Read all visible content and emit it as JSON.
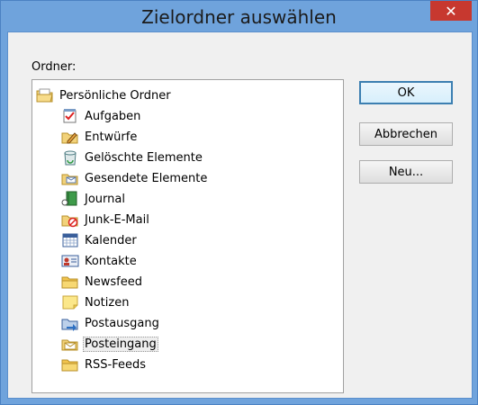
{
  "window": {
    "title": "Zielordner auswählen",
    "close_glyph": "✕"
  },
  "folder_label": "Ordner:",
  "tree": {
    "root": {
      "label": "Persönliche Ordner",
      "icon": "personal-folders-icon"
    },
    "items": [
      {
        "label": "Aufgaben",
        "icon": "tasks-icon"
      },
      {
        "label": "Entwürfe",
        "icon": "drafts-icon"
      },
      {
        "label": "Gelöschte Elemente",
        "icon": "deleted-items-icon"
      },
      {
        "label": "Gesendete Elemente",
        "icon": "sent-items-icon"
      },
      {
        "label": "Journal",
        "icon": "journal-icon"
      },
      {
        "label": "Junk-E-Mail",
        "icon": "junk-mail-icon"
      },
      {
        "label": "Kalender",
        "icon": "calendar-icon"
      },
      {
        "label": "Kontakte",
        "icon": "contacts-icon"
      },
      {
        "label": "Newsfeed",
        "icon": "folder-icon"
      },
      {
        "label": "Notizen",
        "icon": "notes-icon"
      },
      {
        "label": "Postausgang",
        "icon": "outbox-icon"
      },
      {
        "label": "Posteingang",
        "icon": "inbox-icon",
        "selected": true
      },
      {
        "label": "RSS-Feeds",
        "icon": "folder-icon"
      }
    ]
  },
  "buttons": {
    "ok": "OK",
    "cancel": "Abbrechen",
    "new": "Neu..."
  },
  "colors": {
    "frame": "#6fa3dc",
    "close": "#c7382f",
    "selection": "#eeeeee"
  }
}
